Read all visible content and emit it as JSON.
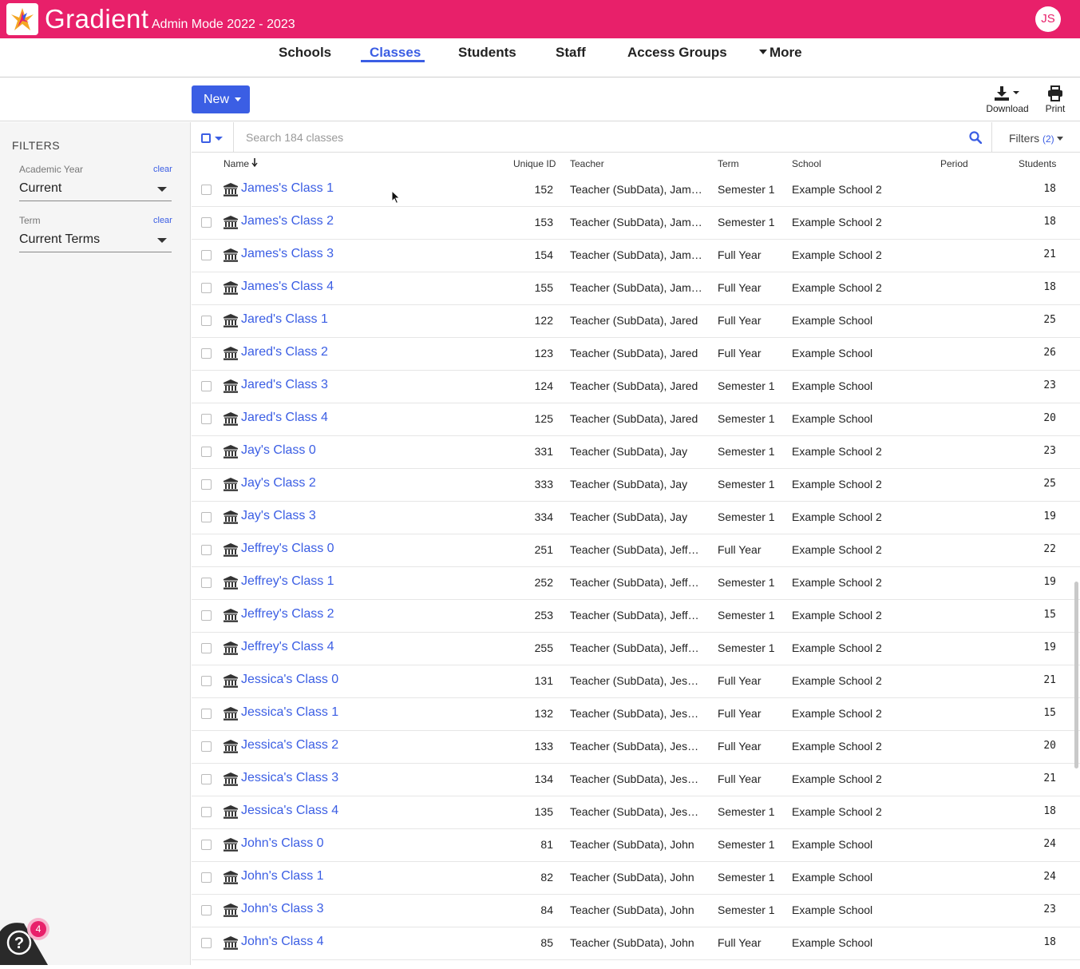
{
  "app": {
    "name": "Gradient",
    "subtitle": "Admin Mode 2022 - 2023",
    "user_initials": "JS",
    "accent": "#e8206a",
    "link": "#3b5ee4"
  },
  "nav": {
    "items": [
      "Schools",
      "Classes",
      "Students",
      "Staff",
      "Access Groups",
      "More"
    ],
    "active": "Classes"
  },
  "toolbar": {
    "new_label": "New",
    "download_label": "Download",
    "print_label": "Print"
  },
  "filters": {
    "title": "FILTERS",
    "academic_year": {
      "label": "Academic Year",
      "clear": "clear",
      "value": "Current"
    },
    "term": {
      "label": "Term",
      "clear": "clear",
      "value": "Current Terms"
    }
  },
  "search": {
    "placeholder": "Search 184 classes",
    "filters_label": "Filters",
    "filters_count": "(2)"
  },
  "columns": [
    "Name",
    "Unique ID",
    "Teacher",
    "Term",
    "School",
    "Period",
    "Students"
  ],
  "rows": [
    {
      "name": "James's Class 1",
      "uid": "152",
      "teacher": "Teacher (SubData), James",
      "term": "Semester 1",
      "school": "Example School 2",
      "period": "",
      "students": "18"
    },
    {
      "name": "James's Class 2",
      "uid": "153",
      "teacher": "Teacher (SubData), James",
      "term": "Semester 1",
      "school": "Example School 2",
      "period": "",
      "students": "18"
    },
    {
      "name": "James's Class 3",
      "uid": "154",
      "teacher": "Teacher (SubData), James",
      "term": "Full Year",
      "school": "Example School 2",
      "period": "",
      "students": "21"
    },
    {
      "name": "James's Class 4",
      "uid": "155",
      "teacher": "Teacher (SubData), James",
      "term": "Full Year",
      "school": "Example School 2",
      "period": "",
      "students": "18"
    },
    {
      "name": "Jared's Class 1",
      "uid": "122",
      "teacher": "Teacher (SubData), Jared",
      "term": "Full Year",
      "school": "Example School",
      "period": "",
      "students": "25"
    },
    {
      "name": "Jared's Class 2",
      "uid": "123",
      "teacher": "Teacher (SubData), Jared",
      "term": "Full Year",
      "school": "Example School",
      "period": "",
      "students": "26"
    },
    {
      "name": "Jared's Class 3",
      "uid": "124",
      "teacher": "Teacher (SubData), Jared",
      "term": "Semester 1",
      "school": "Example School",
      "period": "",
      "students": "23"
    },
    {
      "name": "Jared's Class 4",
      "uid": "125",
      "teacher": "Teacher (SubData), Jared",
      "term": "Semester 1",
      "school": "Example School",
      "period": "",
      "students": "20"
    },
    {
      "name": "Jay's Class 0",
      "uid": "331",
      "teacher": "Teacher (SubData), Jay",
      "term": "Semester 1",
      "school": "Example School 2",
      "period": "",
      "students": "23"
    },
    {
      "name": "Jay's Class 2",
      "uid": "333",
      "teacher": "Teacher (SubData), Jay",
      "term": "Semester 1",
      "school": "Example School 2",
      "period": "",
      "students": "25"
    },
    {
      "name": "Jay's Class 3",
      "uid": "334",
      "teacher": "Teacher (SubData), Jay",
      "term": "Semester 1",
      "school": "Example School 2",
      "period": "",
      "students": "19"
    },
    {
      "name": "Jeffrey's Class 0",
      "uid": "251",
      "teacher": "Teacher (SubData), Jeffrey",
      "term": "Full Year",
      "school": "Example School 2",
      "period": "",
      "students": "22"
    },
    {
      "name": "Jeffrey's Class 1",
      "uid": "252",
      "teacher": "Teacher (SubData), Jeffrey",
      "term": "Semester 1",
      "school": "Example School 2",
      "period": "",
      "students": "19"
    },
    {
      "name": "Jeffrey's Class 2",
      "uid": "253",
      "teacher": "Teacher (SubData), Jeffrey",
      "term": "Semester 1",
      "school": "Example School 2",
      "period": "",
      "students": "15"
    },
    {
      "name": "Jeffrey's Class 4",
      "uid": "255",
      "teacher": "Teacher (SubData), Jeffrey",
      "term": "Semester 1",
      "school": "Example School 2",
      "period": "",
      "students": "19"
    },
    {
      "name": "Jessica's Class 0",
      "uid": "131",
      "teacher": "Teacher (SubData), Jessi...",
      "term": "Full Year",
      "school": "Example School 2",
      "period": "",
      "students": "21"
    },
    {
      "name": "Jessica's Class 1",
      "uid": "132",
      "teacher": "Teacher (SubData), Jessi...",
      "term": "Full Year",
      "school": "Example School 2",
      "period": "",
      "students": "15"
    },
    {
      "name": "Jessica's Class 2",
      "uid": "133",
      "teacher": "Teacher (SubData), Jessi...",
      "term": "Full Year",
      "school": "Example School 2",
      "period": "",
      "students": "20"
    },
    {
      "name": "Jessica's Class 3",
      "uid": "134",
      "teacher": "Teacher (SubData), Jessi...",
      "term": "Full Year",
      "school": "Example School 2",
      "period": "",
      "students": "21"
    },
    {
      "name": "Jessica's Class 4",
      "uid": "135",
      "teacher": "Teacher (SubData), Jessi...",
      "term": "Semester 1",
      "school": "Example School 2",
      "period": "",
      "students": "18"
    },
    {
      "name": "John's Class 0",
      "uid": "81",
      "teacher": "Teacher (SubData), John",
      "term": "Semester 1",
      "school": "Example School",
      "period": "",
      "students": "24"
    },
    {
      "name": "John's Class 1",
      "uid": "82",
      "teacher": "Teacher (SubData), John",
      "term": "Semester 1",
      "school": "Example School",
      "period": "",
      "students": "24"
    },
    {
      "name": "John's Class 3",
      "uid": "84",
      "teacher": "Teacher (SubData), John",
      "term": "Semester 1",
      "school": "Example School",
      "period": "",
      "students": "23"
    },
    {
      "name": "John's Class 4",
      "uid": "85",
      "teacher": "Teacher (SubData), John",
      "term": "Full Year",
      "school": "Example School",
      "period": "",
      "students": "18"
    }
  ],
  "help": {
    "badge_count": "4",
    "icon": "question-icon"
  }
}
